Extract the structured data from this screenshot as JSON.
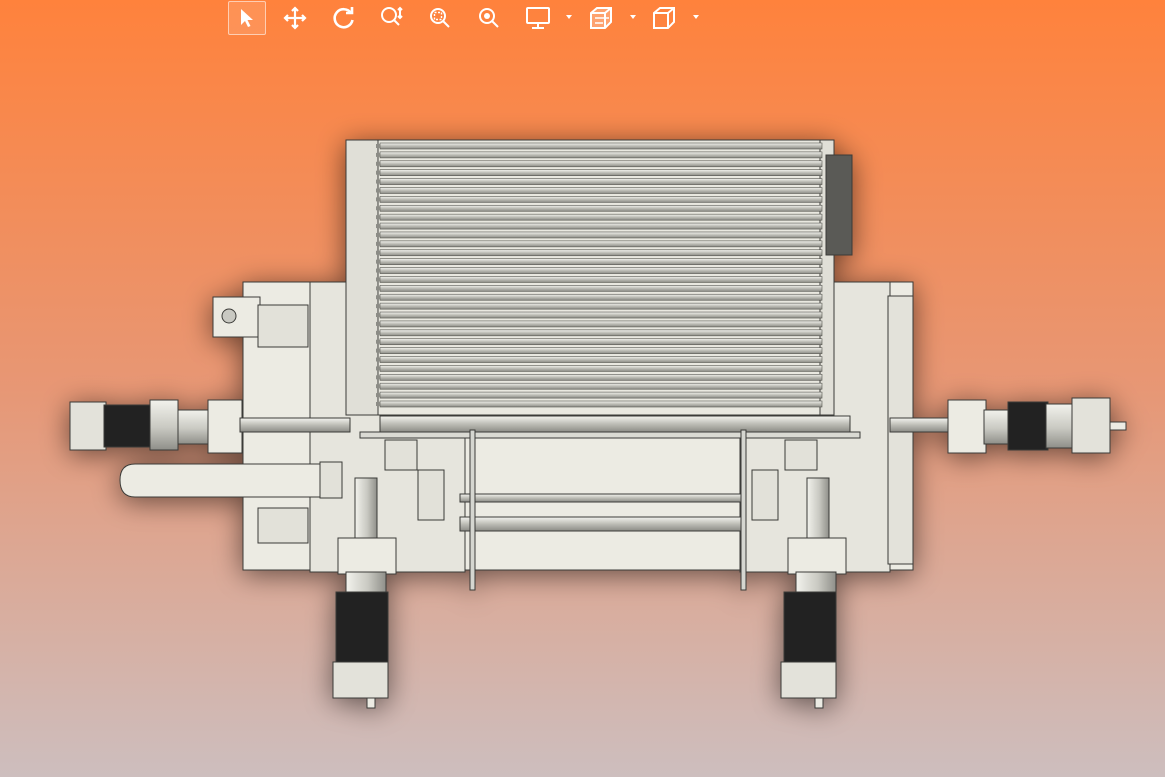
{
  "colors": {
    "background_top": "#FF823C",
    "background_mid": "#E79775",
    "background_bottom": "#CDBEBE",
    "icon": "#FFFFFF",
    "part_fill": "#ECEBE3",
    "part_line": "#3B3B38",
    "rail_fill": "#D5D6D0",
    "motor_dark": "#232323"
  },
  "toolbar": {
    "tools": [
      {
        "id": "select",
        "icon": "select-arrow-icon",
        "active": true
      },
      {
        "id": "pan",
        "icon": "pan-move-icon",
        "active": false
      },
      {
        "id": "rotate",
        "icon": "rotate-icon",
        "active": false
      },
      {
        "id": "zoom-in-out",
        "icon": "zoom-in-out-icon",
        "active": false
      },
      {
        "id": "zoom-area",
        "icon": "zoom-area-icon",
        "active": false
      },
      {
        "id": "zoom-fit",
        "icon": "zoom-fit-icon",
        "active": false
      },
      {
        "id": "display-style",
        "icon": "display-monitor-icon",
        "active": false,
        "dropdown": true
      },
      {
        "id": "section-view",
        "icon": "section-view-icon",
        "active": false,
        "dropdown": true
      },
      {
        "id": "view-orientation",
        "icon": "view-cube-icon",
        "active": false,
        "dropdown": true
      }
    ]
  },
  "model": {
    "roller_count": 30
  }
}
